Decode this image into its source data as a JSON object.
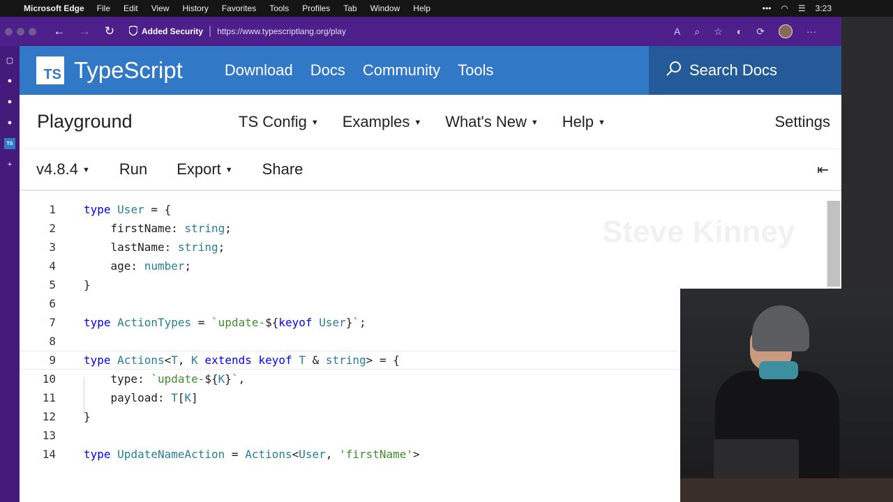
{
  "menubar": {
    "apple": "",
    "app": "Microsoft Edge",
    "items": [
      "File",
      "Edit",
      "View",
      "History",
      "Favorites",
      "Tools",
      "Profiles",
      "Tab",
      "Window",
      "Help"
    ],
    "time": "3:23",
    "more": "•••"
  },
  "browser": {
    "security_label": "Added Security",
    "url": "https://www.typescriptlang.org/play",
    "back": "←",
    "forward": "→",
    "reload": "↻",
    "menu": "···"
  },
  "sidebar": {
    "items": [
      "▢",
      "●",
      "●",
      "●",
      "TS",
      "+"
    ]
  },
  "ts_header": {
    "logo": "TS",
    "brand": "TypeScript",
    "nav": [
      "Download",
      "Docs",
      "Community",
      "Tools"
    ],
    "search": "Search Docs"
  },
  "playground_bar": {
    "title": "Playground",
    "menus": [
      "TS Config",
      "Examples",
      "What's New",
      "Help"
    ],
    "settings": "Settings"
  },
  "toolbar": {
    "version": "v4.8.4",
    "run": "Run",
    "export": "Export",
    "share": "Share",
    "collapse": "⇤"
  },
  "editor": {
    "line_numbers": [
      "1",
      "2",
      "3",
      "4",
      "5",
      "6",
      "7",
      "8",
      "9",
      "10",
      "11",
      "12",
      "13",
      "14"
    ],
    "watermark": "Steve Kinney"
  },
  "colors": {
    "ts_blue": "#3178c6",
    "edge_purple": "#4c1f8a",
    "keyword": "#0000ff",
    "string_literal": "#3c8f2a"
  }
}
